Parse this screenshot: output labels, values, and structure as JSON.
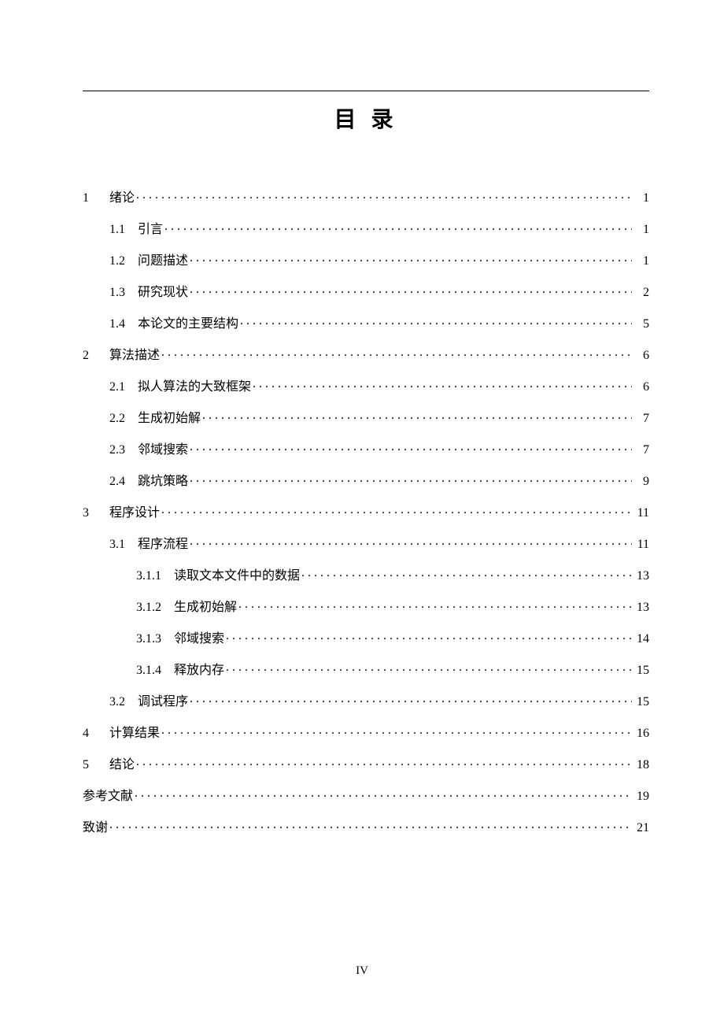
{
  "title": "目 录",
  "footer": "IV",
  "toc": [
    {
      "level": 1,
      "num": "1",
      "text": "绪论",
      "page": "1"
    },
    {
      "level": 2,
      "num": "1.1",
      "text": "引言",
      "page": "1"
    },
    {
      "level": 2,
      "num": "1.2",
      "text": "问题描述",
      "page": "1"
    },
    {
      "level": 2,
      "num": "1.3",
      "text": "研究现状",
      "page": "2"
    },
    {
      "level": 2,
      "num": "1.4",
      "text": "本论文的主要结构",
      "page": "5"
    },
    {
      "level": 1,
      "num": "2",
      "text": "算法描述",
      "page": "6"
    },
    {
      "level": 2,
      "num": "2.1",
      "text": "拟人算法的大致框架",
      "page": "6"
    },
    {
      "level": 2,
      "num": "2.2",
      "text": "生成初始解",
      "page": "7"
    },
    {
      "level": 2,
      "num": "2.3",
      "text": "邻域搜索",
      "page": "7"
    },
    {
      "level": 2,
      "num": "2.4",
      "text": "跳坑策略",
      "page": "9"
    },
    {
      "level": 1,
      "num": "3",
      "text": "程序设计",
      "page": "11"
    },
    {
      "level": 2,
      "num": "3.1",
      "text": "程序流程",
      "page": "11"
    },
    {
      "level": 3,
      "num": "3.1.1",
      "text": "读取文本文件中的数据",
      "page": "13"
    },
    {
      "level": 3,
      "num": "3.1.2",
      "text": "生成初始解",
      "page": "13"
    },
    {
      "level": 3,
      "num": "3.1.3",
      "text": "邻域搜索",
      "page": "14"
    },
    {
      "level": 3,
      "num": "3.1.4",
      "text": "释放内存",
      "page": "15"
    },
    {
      "level": 2,
      "num": "3.2",
      "text": "调试程序",
      "page": "15"
    },
    {
      "level": 1,
      "num": "4",
      "text": "计算结果",
      "page": "16"
    },
    {
      "level": 1,
      "num": "5",
      "text": "结论",
      "page": "18"
    },
    {
      "level": 1,
      "num": "",
      "text": "参考文献",
      "page": "19"
    },
    {
      "level": 1,
      "num": "",
      "text": "致谢",
      "page": "21"
    }
  ]
}
